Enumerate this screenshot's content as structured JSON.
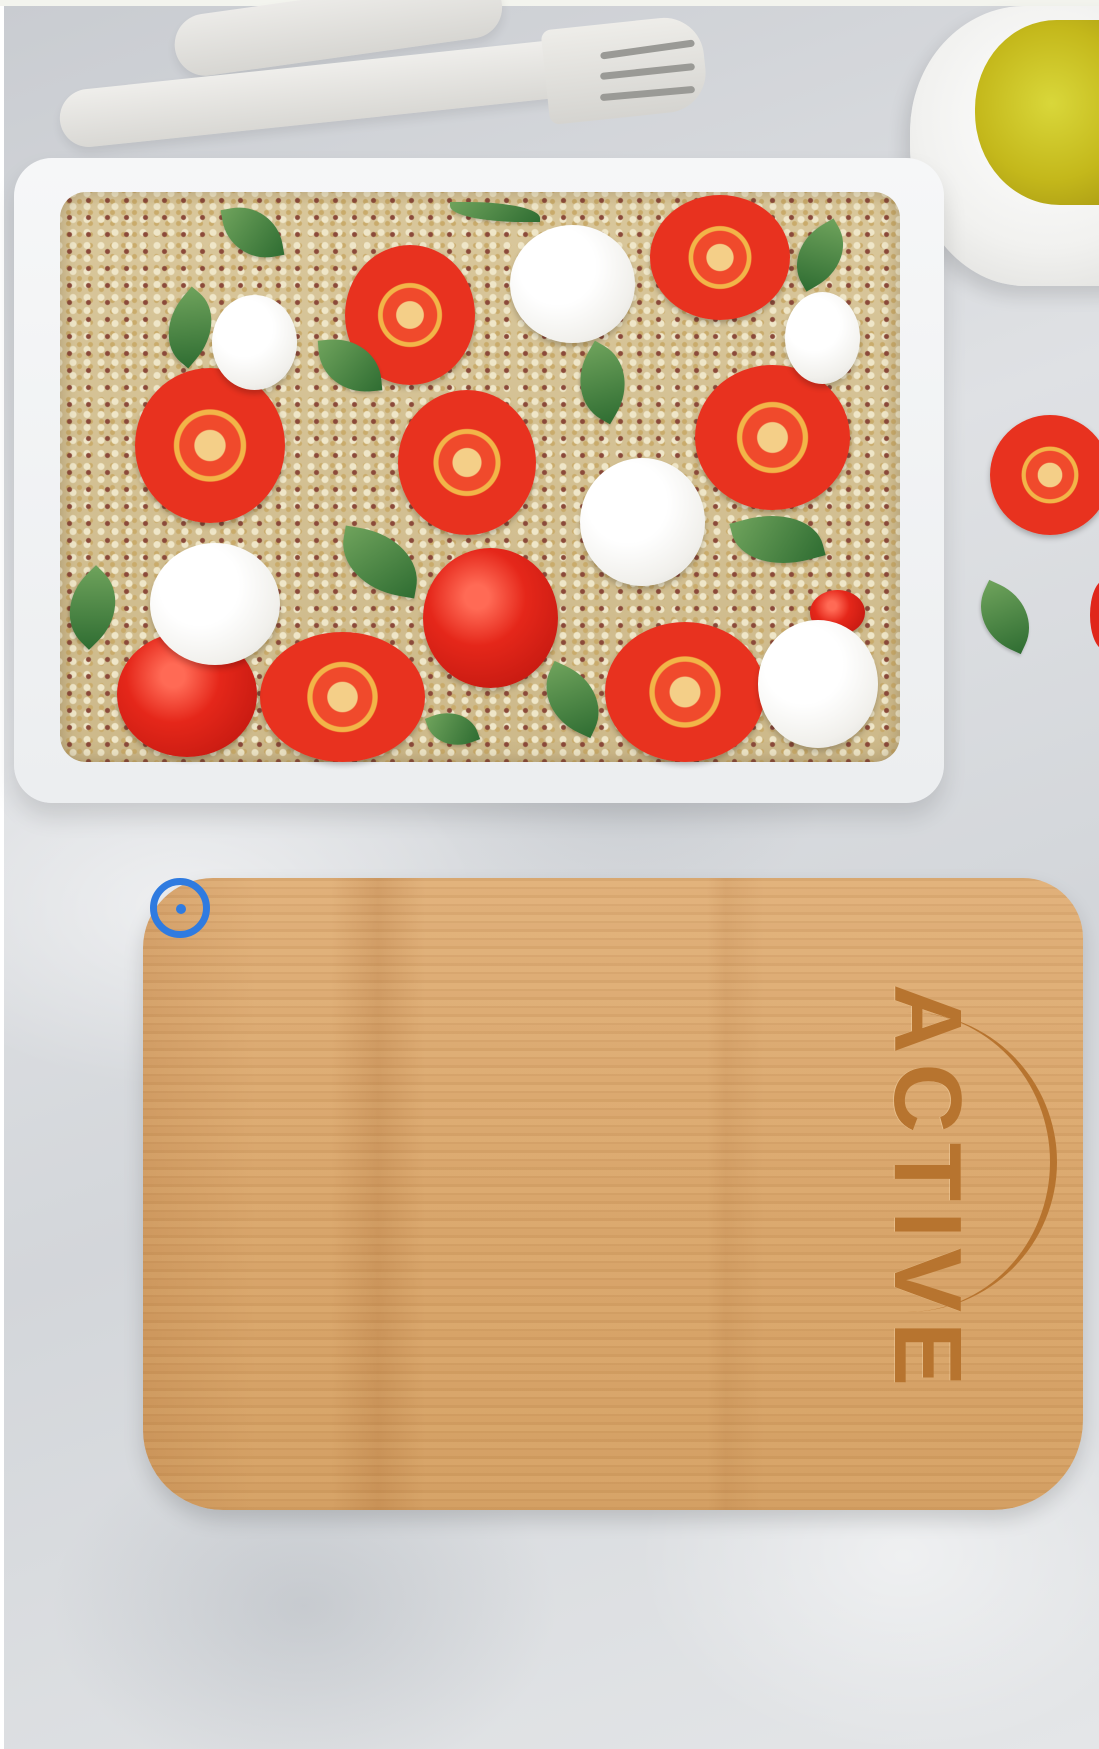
{
  "board": {
    "engraving": "ACTIVE"
  },
  "colors": {
    "pointer": "#2f7be0",
    "wood": "#d9a66c",
    "engraving": "#b7742f"
  },
  "icons": [
    "click-target-icon"
  ]
}
